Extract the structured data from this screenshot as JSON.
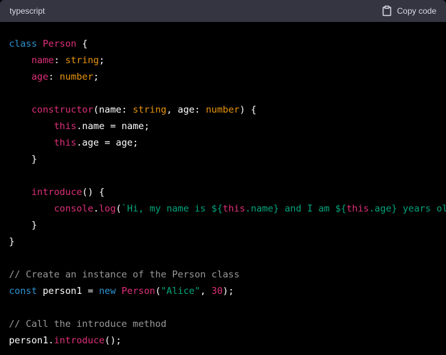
{
  "header": {
    "language": "typescript",
    "copy_label": "Copy code",
    "copy_icon": "clipboard-icon"
  },
  "colors": {
    "keyword": "#2e95d3",
    "type": "#df3079",
    "property": "#df3079",
    "builtin_type": "#e9950c",
    "string": "#00a67d",
    "number": "#df3079",
    "comment": "#999999",
    "plain": "#ffffff",
    "header_bg": "#343541",
    "code_bg": "#000000"
  },
  "code_lines": [
    [
      [
        "keyword",
        "class "
      ],
      [
        "type",
        "Person"
      ],
      [
        "plain",
        " {"
      ]
    ],
    [
      [
        "plain",
        "    "
      ],
      [
        "property",
        "name"
      ],
      [
        "plain",
        ": "
      ],
      [
        "builtin_type",
        "string"
      ],
      [
        "plain",
        ";"
      ]
    ],
    [
      [
        "plain",
        "    "
      ],
      [
        "property",
        "age"
      ],
      [
        "plain",
        ": "
      ],
      [
        "builtin_type",
        "number"
      ],
      [
        "plain",
        ";"
      ]
    ],
    [],
    [
      [
        "plain",
        "    "
      ],
      [
        "property",
        "constructor"
      ],
      [
        "plain",
        "(name: "
      ],
      [
        "builtin_type",
        "string"
      ],
      [
        "plain",
        ", age: "
      ],
      [
        "builtin_type",
        "number"
      ],
      [
        "plain",
        ") {"
      ]
    ],
    [
      [
        "plain",
        "        "
      ],
      [
        "type",
        "this"
      ],
      [
        "plain",
        ".name = name;"
      ]
    ],
    [
      [
        "plain",
        "        "
      ],
      [
        "type",
        "this"
      ],
      [
        "plain",
        ".age = age;"
      ]
    ],
    [
      [
        "plain",
        "    }"
      ]
    ],
    [],
    [
      [
        "plain",
        "    "
      ],
      [
        "property",
        "introduce"
      ],
      [
        "plain",
        "() {"
      ]
    ],
    [
      [
        "plain",
        "        "
      ],
      [
        "type",
        "console"
      ],
      [
        "plain",
        "."
      ],
      [
        "property",
        "log"
      ],
      [
        "plain",
        "("
      ],
      [
        "string",
        "`Hi, my name is ${"
      ],
      [
        "type",
        "this"
      ],
      [
        "string",
        ".name} and I am ${"
      ],
      [
        "type",
        "this"
      ],
      [
        "string",
        ".age} years old.`"
      ],
      [
        "plain",
        ");"
      ]
    ],
    [
      [
        "plain",
        "    }"
      ]
    ],
    [
      [
        "plain",
        "}"
      ]
    ],
    [],
    [
      [
        "comment",
        "// Create an instance of the Person class"
      ]
    ],
    [
      [
        "keyword",
        "const "
      ],
      [
        "plain",
        "person1 = "
      ],
      [
        "keyword",
        "new "
      ],
      [
        "type",
        "Person"
      ],
      [
        "plain",
        "("
      ],
      [
        "string",
        "\"Alice\""
      ],
      [
        "plain",
        ", "
      ],
      [
        "number",
        "30"
      ],
      [
        "plain",
        ");"
      ]
    ],
    [],
    [
      [
        "comment",
        "// Call the introduce method"
      ]
    ],
    [
      [
        "plain",
        "person1."
      ],
      [
        "property",
        "introduce"
      ],
      [
        "plain",
        "();"
      ]
    ]
  ]
}
